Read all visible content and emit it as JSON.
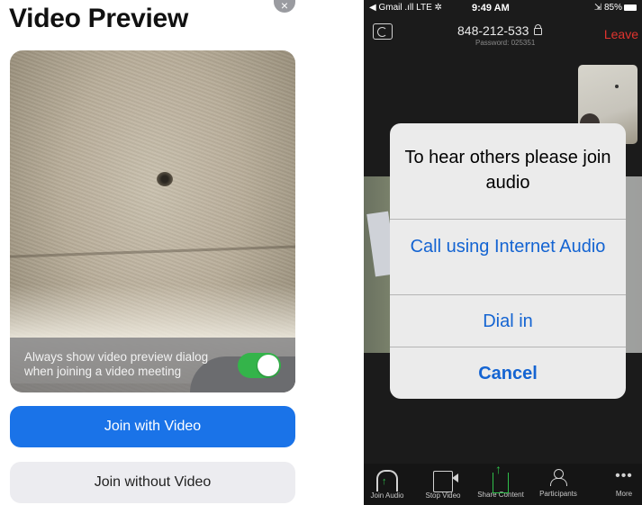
{
  "left_panel": {
    "title": "Video Preview",
    "close_symbol": "×",
    "toggle_text": "Always show video preview dialog when joining a video meeting",
    "toggle_state": "on",
    "join_with_video_label": "Join with Video",
    "join_without_video_label": "Join without Video",
    "colors": {
      "primary": "#1a73e8",
      "toggle_on": "#34b44a"
    }
  },
  "phone": {
    "status_bar": {
      "carrier": "◀ Gmail .ıll LTE ✲",
      "time": "9:49 AM",
      "battery": "⇲ 85%"
    },
    "meeting_id": "848-212-533",
    "password": "Password: 025351",
    "leave_label": "Leave",
    "dialog": {
      "title": "To hear others please join audio",
      "options": [
        "Call using Internet Audio",
        "Dial in"
      ],
      "cancel_label": "Cancel"
    },
    "toolbar": [
      {
        "label": "Join Audio",
        "icon": "headphone-icon"
      },
      {
        "label": "Stop Video",
        "icon": "video-camera-icon"
      },
      {
        "label": "Share Content",
        "icon": "share-icon"
      },
      {
        "label": "Participants",
        "icon": "participants-icon"
      },
      {
        "label": "More",
        "icon": "more-icon"
      }
    ],
    "colors": {
      "leave": "#e0332e",
      "dialog_link": "#1464d2",
      "green": "#2fbf4a"
    }
  }
}
